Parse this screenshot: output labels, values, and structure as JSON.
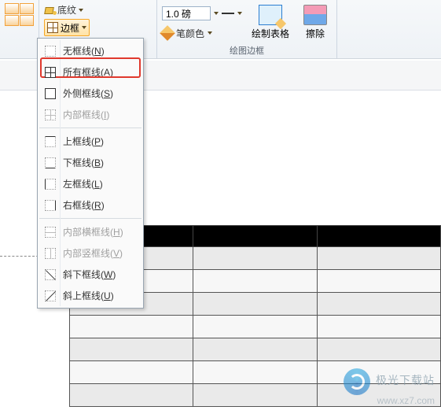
{
  "ribbon": {
    "shading_label": "底纹",
    "border_label": "边框",
    "line_weight_value": "1.0 磅",
    "pen_color_label": "笔颜色",
    "draw_table_label": "绘制表格",
    "eraser_label": "擦除",
    "group_drawborders_label": "绘图边框"
  },
  "menu": {
    "items": [
      {
        "label": "无框线",
        "key": "N",
        "icon": "none",
        "disabled": false
      },
      {
        "label": "所有框线",
        "key": "A",
        "icon": "all",
        "disabled": false
      },
      {
        "label": "外侧框线",
        "key": "S",
        "icon": "outside",
        "disabled": false
      },
      {
        "label": "内部框线",
        "key": "I",
        "icon": "inside",
        "disabled": true
      },
      {
        "label": "上框线",
        "key": "P",
        "icon": "top",
        "disabled": false
      },
      {
        "label": "下框线",
        "key": "B",
        "icon": "bottom",
        "disabled": false
      },
      {
        "label": "左框线",
        "key": "L",
        "icon": "left",
        "disabled": false
      },
      {
        "label": "右框线",
        "key": "R",
        "icon": "right",
        "disabled": false
      },
      {
        "label": "内部横框线",
        "key": "H",
        "icon": "hinside",
        "disabled": true
      },
      {
        "label": "内部竖框线",
        "key": "V",
        "icon": "vinside",
        "disabled": true
      },
      {
        "label": "斜下框线",
        "key": "W",
        "icon": "diagdown",
        "disabled": false
      },
      {
        "label": "斜上框线",
        "key": "U",
        "icon": "diagup",
        "disabled": false
      }
    ]
  },
  "watermark": {
    "brand": "极光下载站",
    "url": "www.xz7.com"
  }
}
